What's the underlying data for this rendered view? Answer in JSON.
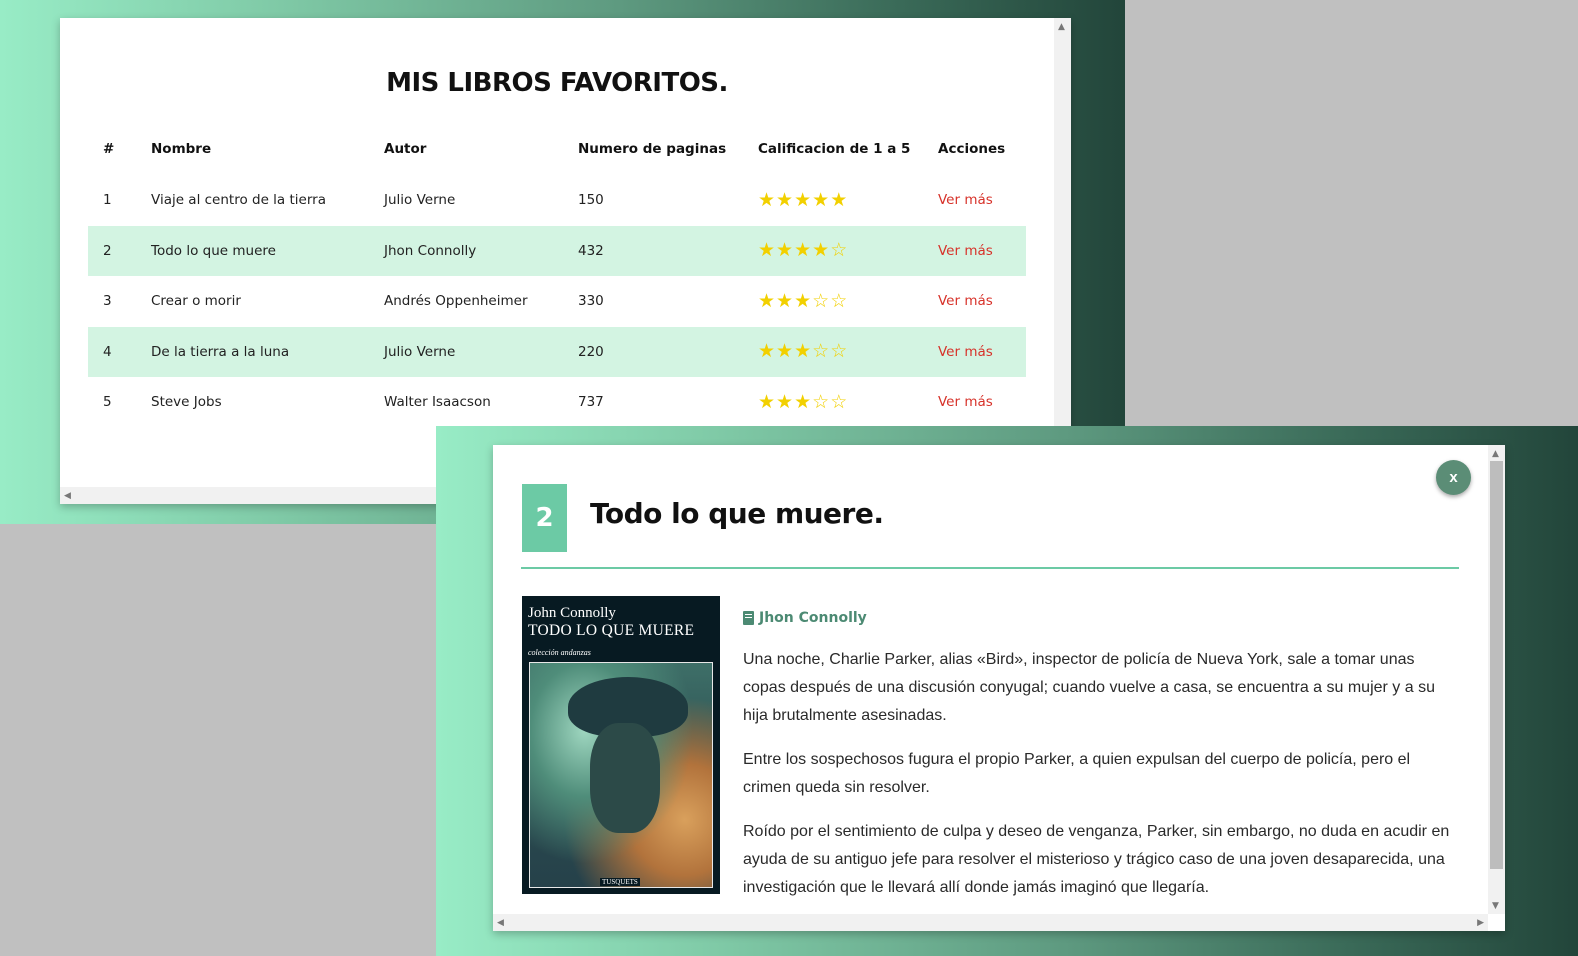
{
  "list": {
    "title": "MIS LIBROS FAVORITOS.",
    "columns": [
      "#",
      "Nombre",
      "Autor",
      "Numero de paginas",
      "Calificacion de 1 a 5",
      "Acciones"
    ],
    "rows": [
      {
        "num": "1",
        "name": "Viaje al centro de la tierra",
        "author": "Julio Verne",
        "pages": "150",
        "rating": 5,
        "action": "Ver más"
      },
      {
        "num": "2",
        "name": "Todo lo que muere",
        "author": "Jhon Connolly",
        "pages": "432",
        "rating": 4,
        "action": "Ver más"
      },
      {
        "num": "3",
        "name": "Crear o morir",
        "author": "Andrés Oppenheimer",
        "pages": "330",
        "rating": 3,
        "action": "Ver más"
      },
      {
        "num": "4",
        "name": "De la tierra a la luna",
        "author": "Julio Verne",
        "pages": "220",
        "rating": 3,
        "action": "Ver más"
      },
      {
        "num": "5",
        "name": "Steve Jobs",
        "author": "Walter Isaacson",
        "pages": "737",
        "rating": 3,
        "action": "Ver más"
      }
    ]
  },
  "detail": {
    "close_label": "x",
    "number": "2",
    "title": "Todo lo que muere.",
    "author": "Jhon Connolly",
    "author_icon": "book-icon",
    "cover": {
      "author": "John Connolly",
      "title": "TODO LO QUE MUERE",
      "collection": "colección andanzas",
      "publisher": "TUSQUETS"
    },
    "paragraphs": [
      "Una noche, Charlie Parker, alias «Bird», inspector de policía de Nueva York, sale a tomar unas copas después de una discusión conyugal; cuando vuelve a casa, se encuentra a su mujer y a su hija brutalmente asesinadas.",
      "Entre los sospechosos fugura el propio Parker, a quien expulsan del cuerpo de policía, pero el crimen queda sin resolver.",
      "Roído por el sentimiento de culpa y deseo de venganza, Parker, sin embargo, no duda en acudir en ayuda de su antiguo jefe para resolver el misterioso y trágico caso de una joven desaparecida, una investigación que le llevará allí donde jamás imaginó que llegaría."
    ]
  },
  "colors": {
    "accent": "#6ccaa5",
    "row_highlight": "#d3f4e2",
    "link": "#d7322a",
    "star": "#f2d000",
    "author_text": "#4c8a73"
  }
}
